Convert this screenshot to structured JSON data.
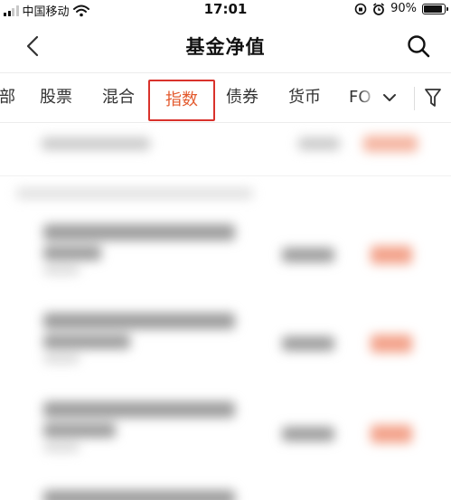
{
  "status_bar": {
    "carrier": "中国移动",
    "time": "17:01",
    "battery": "90%",
    "battery_level": 0.9
  },
  "nav": {
    "title": "基金净值"
  },
  "tabs": [
    {
      "label": "部",
      "active": false
    },
    {
      "label": "股票",
      "active": false
    },
    {
      "label": "混合",
      "active": false
    },
    {
      "label": "指数",
      "active": true
    },
    {
      "label": "债券",
      "active": false
    },
    {
      "label": "货币",
      "active": false
    },
    {
      "label": "FO",
      "active": false
    }
  ],
  "colors": {
    "active_tab_text": "#e35a2e",
    "active_tab_border": "#d9322c",
    "accent_blurred_value": "#f3a28a"
  }
}
